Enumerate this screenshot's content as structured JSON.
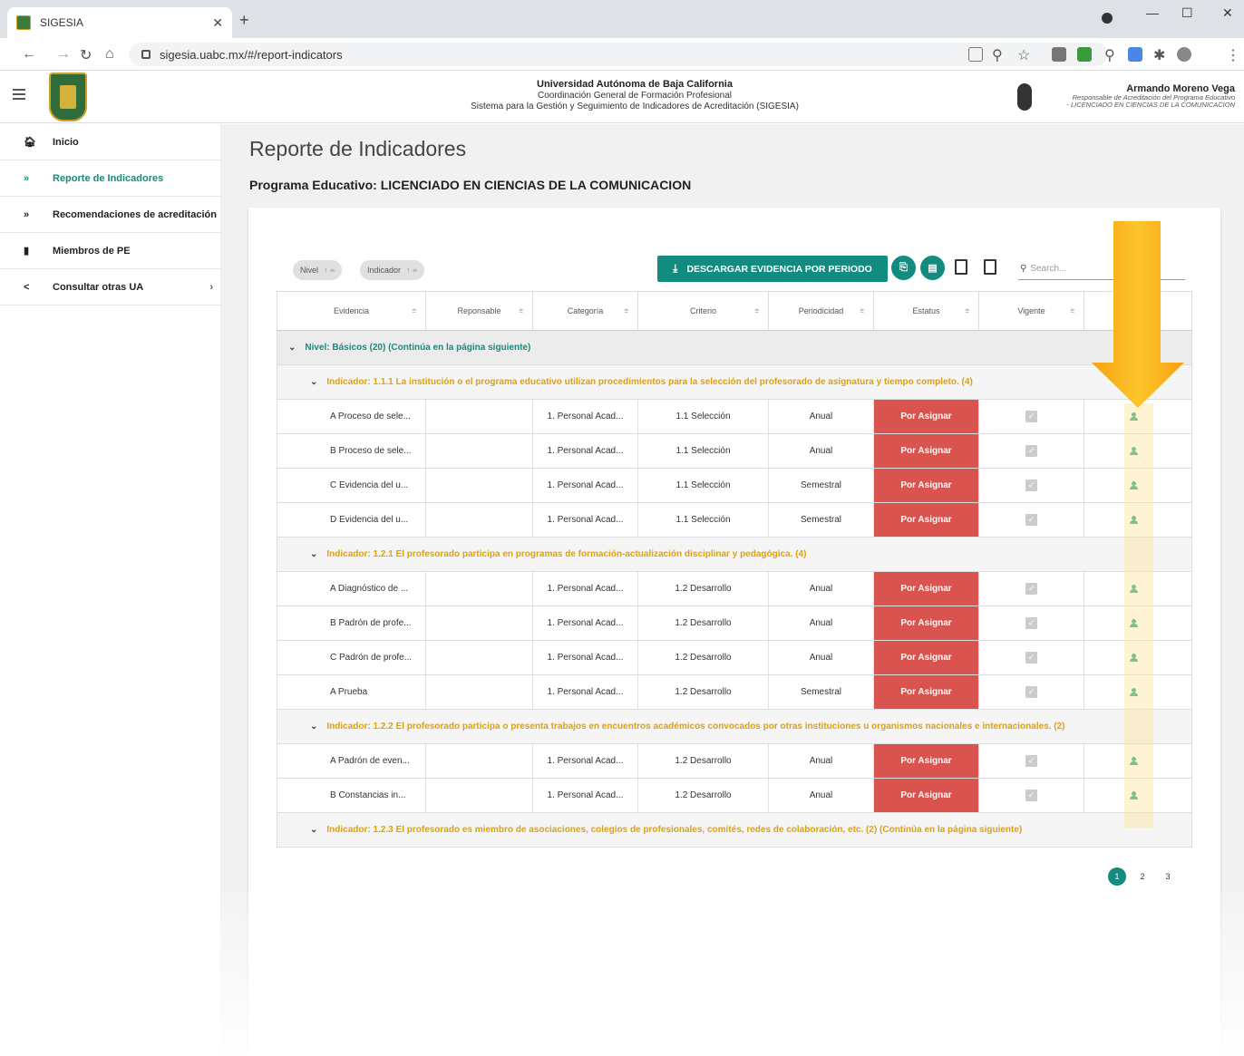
{
  "browser": {
    "tab_title": "SIGESIA",
    "url": "sigesia.uabc.mx/#/report-indicators"
  },
  "header": {
    "line1": "Universidad Autónoma de Baja California",
    "line2": "Coordinación General de Formación Profesional",
    "line3": "Sistema para la Gestión y Seguimiento de Indicadores de Acreditación (SIGESIA)",
    "user_name": "Armando Moreno Vega",
    "user_role_1": "Responsable de Acreditación del Programa Educativo",
    "user_role_2": "- LICENCIADO EN CIENCIAS DE LA COMUNICACION"
  },
  "sidebar": {
    "items": [
      {
        "label": "Inicio",
        "icon": "home-icon"
      },
      {
        "label": "Reporte de Indicadores",
        "icon": "double-chevron-icon"
      },
      {
        "label": "Recomendaciones de acreditación",
        "icon": "double-chevron-icon"
      },
      {
        "label": "Miembros de PE",
        "icon": "bookmark-icon"
      },
      {
        "label": "Consultar otras UA",
        "icon": "share-icon"
      }
    ]
  },
  "main": {
    "title": "Reporte de Indicadores",
    "program": "Programa Educativo: LICENCIADO EN CIENCIAS DE LA COMUNICACION"
  },
  "toolbar": {
    "chip_nivel": "Nivel",
    "chip_indicador": "Indicador",
    "download_label": "DESCARGAR EVIDENCIA POR PERIODO",
    "search_placeholder": "Search..."
  },
  "columns": [
    "Evidencia",
    "Reponsable",
    "Categoría",
    "Criterio",
    "Periodicidad",
    "Estatus",
    "Vigente"
  ],
  "groups": {
    "nivel": "Nivel: Básicos (20) (Continúa en la página siguiente)",
    "ind1": "Indicador: 1.1.1 La institución o el programa educativo utilizan procedimientos para la selección del profesorado de asignatura y tiempo completo. (4)",
    "ind2": "Indicador: 1.2.1 El profesorado participa en programas de formación-actualización disciplinar y pedagógica. (4)",
    "ind3": "Indicador: 1.2.2 El profesorado participa o presenta trabajos en encuentros académicos convocados por otras instituciones u organismos nacionales e internacionales. (2)",
    "ind4": "Indicador: 1.2.3 El profesorado es miembro de asociaciones, colegios de profesionales, comités, redes de colaboración, etc. (2) (Continúa en la página siguiente)"
  },
  "rows": {
    "r1": {
      "evidencia": "A Proceso de sele...",
      "categoria": "1. Personal Acad...",
      "criterio": "1.1 Selección",
      "periodicidad": "Anual",
      "estatus": "Por Asignar"
    },
    "r2": {
      "evidencia": "B Proceso de sele...",
      "categoria": "1. Personal Acad...",
      "criterio": "1.1 Selección",
      "periodicidad": "Anual",
      "estatus": "Por Asignar"
    },
    "r3": {
      "evidencia": "C Evidencia del u...",
      "categoria": "1. Personal Acad...",
      "criterio": "1.1 Selección",
      "periodicidad": "Semestral",
      "estatus": "Por Asignar"
    },
    "r4": {
      "evidencia": "D Evidencia del u...",
      "categoria": "1. Personal Acad...",
      "criterio": "1.1 Selección",
      "periodicidad": "Semestral",
      "estatus": "Por Asignar"
    },
    "r5": {
      "evidencia": "A Diagnóstico de ...",
      "categoria": "1. Personal Acad...",
      "criterio": "1.2 Desarrollo",
      "periodicidad": "Anual",
      "estatus": "Por Asignar"
    },
    "r6": {
      "evidencia": "B Padrón de profe...",
      "categoria": "1. Personal Acad...",
      "criterio": "1.2 Desarrollo",
      "periodicidad": "Anual",
      "estatus": "Por Asignar"
    },
    "r7": {
      "evidencia": "C Padrón de profe...",
      "categoria": "1. Personal Acad...",
      "criterio": "1.2 Desarrollo",
      "periodicidad": "Anual",
      "estatus": "Por Asignar"
    },
    "r8": {
      "evidencia": "A Prueba",
      "categoria": "1. Personal Acad...",
      "criterio": "1.2 Desarrollo",
      "periodicidad": "Semestral",
      "estatus": "Por Asignar"
    },
    "r9": {
      "evidencia": "A Padrón de even...",
      "categoria": "1. Personal Acad...",
      "criterio": "1.2 Desarrollo",
      "periodicidad": "Anual",
      "estatus": "Por Asignar"
    },
    "r10": {
      "evidencia": "B Constancias in...",
      "categoria": "1. Personal Acad...",
      "criterio": "1.2 Desarrollo",
      "periodicidad": "Anual",
      "estatus": "Por Asignar"
    }
  },
  "pager": {
    "p1": "1",
    "p2": "2",
    "p3": "3"
  },
  "colors": {
    "accent": "#128c7e",
    "status_red": "#d9534f",
    "indicator_orange": "#e0a009",
    "arrow": "#fbb821"
  }
}
